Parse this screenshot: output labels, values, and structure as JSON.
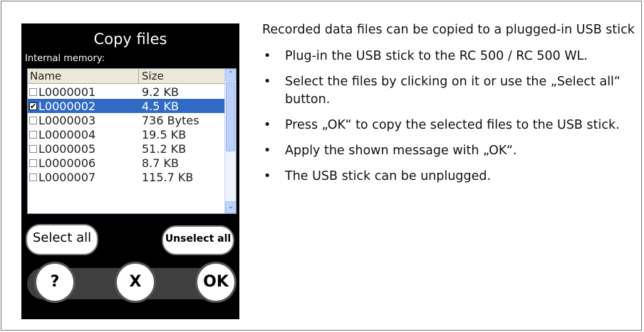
{
  "device": {
    "title": "Copy files",
    "subtitle": "Internal memory:",
    "columns": {
      "name": "Name",
      "size": "Size"
    },
    "files": [
      {
        "name": "L0000001",
        "size": "9.2 KB",
        "checked": false,
        "selected": false
      },
      {
        "name": "L0000002",
        "size": "4.5 KB",
        "checked": true,
        "selected": true
      },
      {
        "name": "L0000003",
        "size": "736 Bytes",
        "checked": false,
        "selected": false
      },
      {
        "name": "L0000004",
        "size": "19.5 KB",
        "checked": false,
        "selected": false
      },
      {
        "name": "L0000005",
        "size": "51.2 KB",
        "checked": false,
        "selected": false
      },
      {
        "name": "L0000006",
        "size": "8.7 KB",
        "checked": false,
        "selected": false
      },
      {
        "name": "L0000007",
        "size": "115.7 KB",
        "checked": false,
        "selected": false
      }
    ],
    "buttons": {
      "select_all": "Select all",
      "unselect_all": "Unselect all",
      "help": "?",
      "cancel": "X",
      "ok": "OK"
    },
    "scroll": {
      "up_glyph": "⌃",
      "down_glyph": "⌄"
    },
    "colors": {
      "selection": "#316ac5",
      "screen_background": "#000000"
    }
  },
  "instructions": {
    "intro": "Recorded data files can be copied to a plugged-in USB stick",
    "bullet_glyph": "•",
    "steps": [
      "Plug-in the USB stick to the RC 500 / RC 500 WL.",
      "Select the files by clicking on it or use the „Select all“ button.",
      "Press „OK“ to copy the selected files to the USB stick.",
      "Apply the shown message with „OK“.",
      "The USB stick can be unplugged."
    ]
  }
}
